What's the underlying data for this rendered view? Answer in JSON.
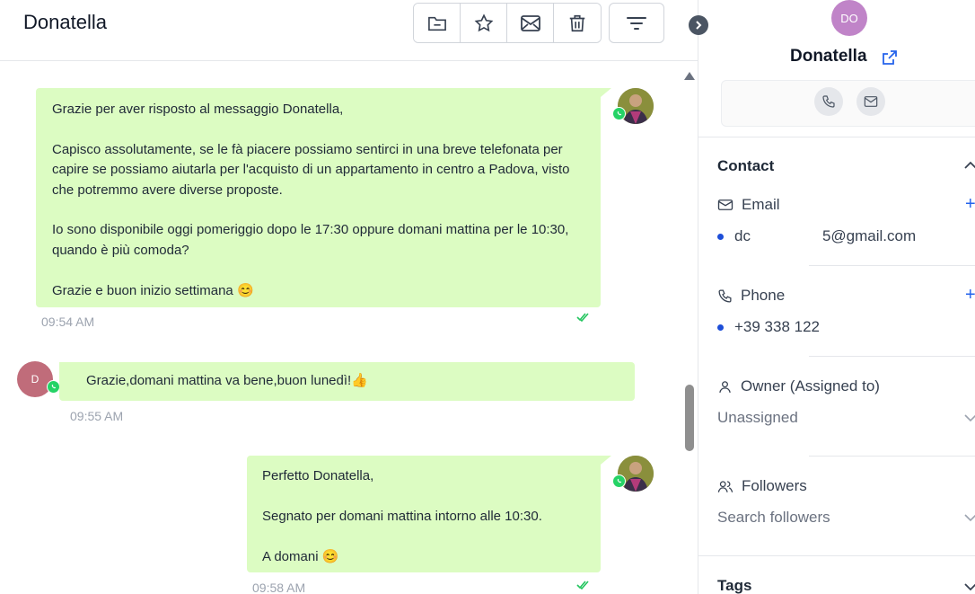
{
  "chat": {
    "title": "Donatella",
    "toolbar": [
      "folder-icon",
      "star-icon",
      "mail-icon",
      "trash-icon"
    ],
    "filter_icon": "filter-icon",
    "messages": [
      {
        "direction": "outgoing",
        "text": "Grazie per aver risposto al messaggio Donatella,\n\nCapisco assolutamente, se le fà piacere possiamo sentirci in una breve telefonata per capire se possiamo aiutarla per l'acquisto di un appartamento in centro a Padova, visto che potremmo avere diverse proposte.\n\nIo sono disponibile oggi pomeriggio dopo le 17:30 oppure domani mattina per le 10:30, quando è più comoda?\n\nGrazie e buon inizio settimana 😊",
        "time": "09:54 AM"
      },
      {
        "direction": "incoming",
        "avatar_initial": "D",
        "text": "Grazie,domani mattina va bene,buon lunedì!👍",
        "time": "09:55 AM"
      },
      {
        "direction": "outgoing",
        "text": "Perfetto Donatella,\n\nSegnato per domani mattina intorno alle 10:30.\n\nA domani 😊",
        "time": "09:58 AM"
      }
    ]
  },
  "contact": {
    "initials": "DO",
    "name": "Donatella",
    "sections": {
      "contact_title": "Contact",
      "email_label": "Email",
      "email_prefix": "dc",
      "email_suffix": "5@gmail.com",
      "phone_label": "Phone",
      "phone_value": "+39 338 122",
      "owner_label": "Owner (Assigned to)",
      "owner_value": "Unassigned",
      "followers_label": "Followers",
      "followers_placeholder": "Search followers",
      "tags_title": "Tags"
    }
  },
  "colors": {
    "bubble": "#dcfcc2",
    "whatsapp": "#25d366",
    "accent": "#2563eb",
    "avatar_incoming": "#c06c7a",
    "avatar_contact": "#c084c8"
  }
}
